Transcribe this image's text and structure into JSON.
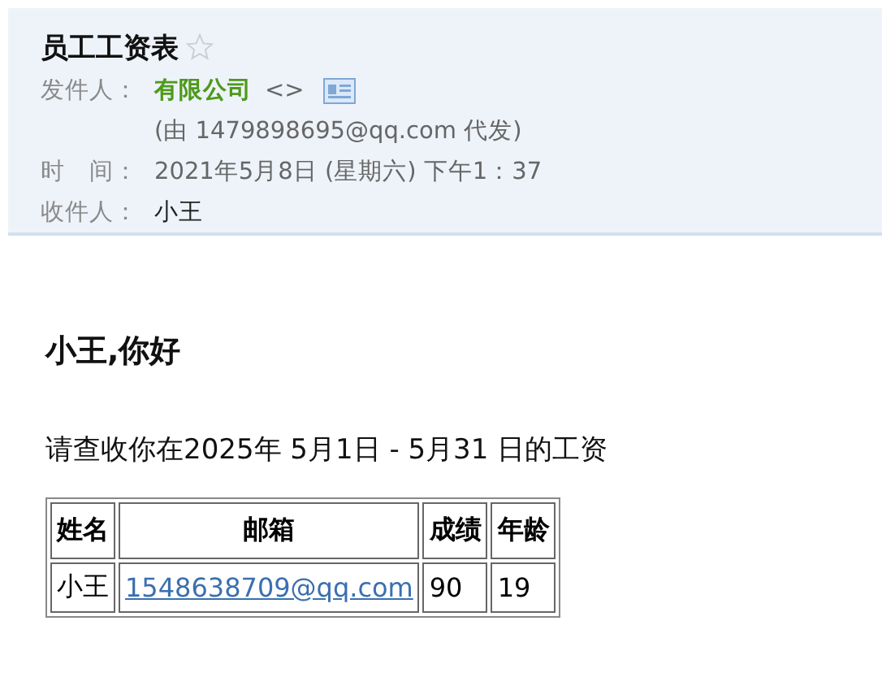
{
  "header": {
    "title": "员工工资表",
    "starred": false,
    "sender": {
      "label": "发件人：",
      "name": "有限公司",
      "address": "<>",
      "via": "(由 1479898695@qq.com 代发)"
    },
    "time": {
      "label": "时　间：",
      "value": "2021年5月8日 (星期六) 下午1：37"
    },
    "recipient": {
      "label": "收件人：",
      "value": "小王"
    }
  },
  "body": {
    "greeting": "小王,你好",
    "message": "请查收你在2025年 5月1日 - 5月31 日的工资",
    "table": {
      "columns": [
        "姓名",
        "邮箱",
        "成绩",
        "年龄"
      ],
      "rows": [
        [
          "小王",
          "1548638709@qq.com",
          "90",
          "19"
        ]
      ]
    }
  }
}
